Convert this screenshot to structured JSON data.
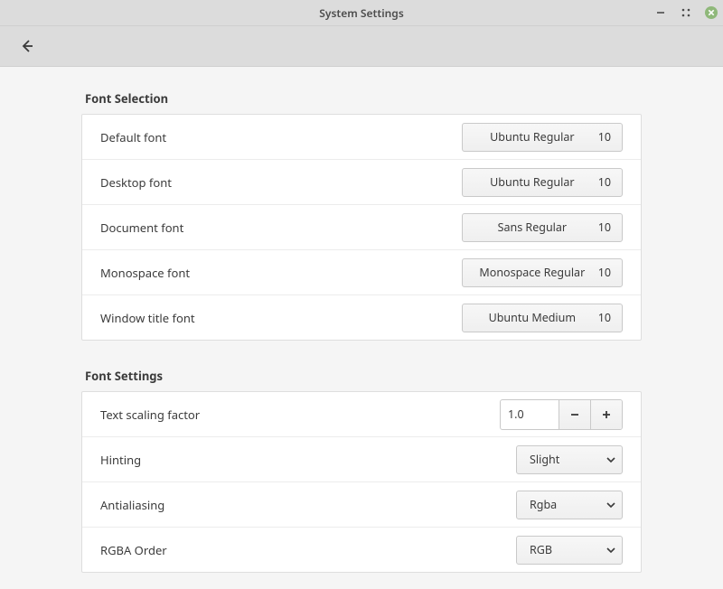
{
  "window": {
    "title": "System Settings"
  },
  "sections": {
    "font_selection": {
      "title": "Font Selection",
      "rows": {
        "default": {
          "label": "Default font",
          "font": "Ubuntu Regular",
          "size": "10"
        },
        "desktop": {
          "label": "Desktop font",
          "font": "Ubuntu Regular",
          "size": "10"
        },
        "document": {
          "label": "Document font",
          "font": "Sans Regular",
          "size": "10"
        },
        "monospace": {
          "label": "Monospace font",
          "font": "Monospace Regular",
          "size": "10"
        },
        "title": {
          "label": "Window title font",
          "font": "Ubuntu Medium",
          "size": "10"
        }
      }
    },
    "font_settings": {
      "title": "Font Settings",
      "rows": {
        "scaling": {
          "label": "Text scaling factor",
          "value": "1.0"
        },
        "hinting": {
          "label": "Hinting",
          "value": "Slight"
        },
        "antialiasing": {
          "label": "Antialiasing",
          "value": "Rgba"
        },
        "rgba_order": {
          "label": "RGBA Order",
          "value": "RGB"
        }
      }
    }
  }
}
